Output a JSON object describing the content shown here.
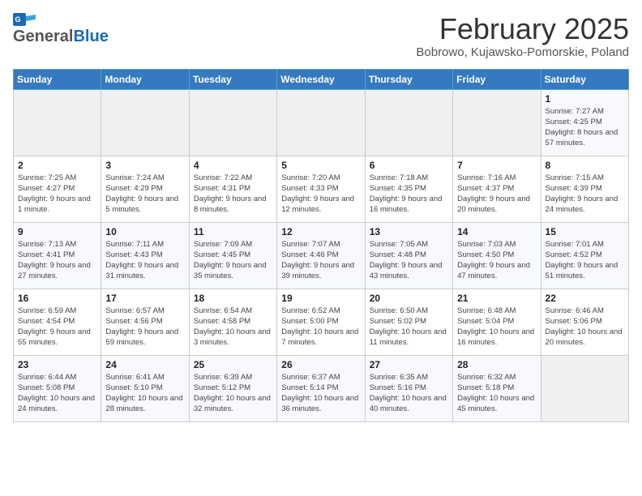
{
  "header": {
    "logo_general": "General",
    "logo_blue": "Blue",
    "title": "February 2025",
    "subtitle": "Bobrowo, Kujawsko-Pomorskie, Poland"
  },
  "weekdays": [
    "Sunday",
    "Monday",
    "Tuesday",
    "Wednesday",
    "Thursday",
    "Friday",
    "Saturday"
  ],
  "weeks": [
    [
      {
        "day": "",
        "info": ""
      },
      {
        "day": "",
        "info": ""
      },
      {
        "day": "",
        "info": ""
      },
      {
        "day": "",
        "info": ""
      },
      {
        "day": "",
        "info": ""
      },
      {
        "day": "",
        "info": ""
      },
      {
        "day": "1",
        "info": "Sunrise: 7:27 AM\nSunset: 4:25 PM\nDaylight: 8 hours and 57 minutes."
      }
    ],
    [
      {
        "day": "2",
        "info": "Sunrise: 7:25 AM\nSunset: 4:27 PM\nDaylight: 9 hours and 1 minute."
      },
      {
        "day": "3",
        "info": "Sunrise: 7:24 AM\nSunset: 4:29 PM\nDaylight: 9 hours and 5 minutes."
      },
      {
        "day": "4",
        "info": "Sunrise: 7:22 AM\nSunset: 4:31 PM\nDaylight: 9 hours and 8 minutes."
      },
      {
        "day": "5",
        "info": "Sunrise: 7:20 AM\nSunset: 4:33 PM\nDaylight: 9 hours and 12 minutes."
      },
      {
        "day": "6",
        "info": "Sunrise: 7:18 AM\nSunset: 4:35 PM\nDaylight: 9 hours and 16 minutes."
      },
      {
        "day": "7",
        "info": "Sunrise: 7:16 AM\nSunset: 4:37 PM\nDaylight: 9 hours and 20 minutes."
      },
      {
        "day": "8",
        "info": "Sunrise: 7:15 AM\nSunset: 4:39 PM\nDaylight: 9 hours and 24 minutes."
      }
    ],
    [
      {
        "day": "9",
        "info": "Sunrise: 7:13 AM\nSunset: 4:41 PM\nDaylight: 9 hours and 27 minutes."
      },
      {
        "day": "10",
        "info": "Sunrise: 7:11 AM\nSunset: 4:43 PM\nDaylight: 9 hours and 31 minutes."
      },
      {
        "day": "11",
        "info": "Sunrise: 7:09 AM\nSunset: 4:45 PM\nDaylight: 9 hours and 35 minutes."
      },
      {
        "day": "12",
        "info": "Sunrise: 7:07 AM\nSunset: 4:46 PM\nDaylight: 9 hours and 39 minutes."
      },
      {
        "day": "13",
        "info": "Sunrise: 7:05 AM\nSunset: 4:48 PM\nDaylight: 9 hours and 43 minutes."
      },
      {
        "day": "14",
        "info": "Sunrise: 7:03 AM\nSunset: 4:50 PM\nDaylight: 9 hours and 47 minutes."
      },
      {
        "day": "15",
        "info": "Sunrise: 7:01 AM\nSunset: 4:52 PM\nDaylight: 9 hours and 51 minutes."
      }
    ],
    [
      {
        "day": "16",
        "info": "Sunrise: 6:59 AM\nSunset: 4:54 PM\nDaylight: 9 hours and 55 minutes."
      },
      {
        "day": "17",
        "info": "Sunrise: 6:57 AM\nSunset: 4:56 PM\nDaylight: 9 hours and 59 minutes."
      },
      {
        "day": "18",
        "info": "Sunrise: 6:54 AM\nSunset: 4:58 PM\nDaylight: 10 hours and 3 minutes."
      },
      {
        "day": "19",
        "info": "Sunrise: 6:52 AM\nSunset: 5:00 PM\nDaylight: 10 hours and 7 minutes."
      },
      {
        "day": "20",
        "info": "Sunrise: 6:50 AM\nSunset: 5:02 PM\nDaylight: 10 hours and 11 minutes."
      },
      {
        "day": "21",
        "info": "Sunrise: 6:48 AM\nSunset: 5:04 PM\nDaylight: 10 hours and 16 minutes."
      },
      {
        "day": "22",
        "info": "Sunrise: 6:46 AM\nSunset: 5:06 PM\nDaylight: 10 hours and 20 minutes."
      }
    ],
    [
      {
        "day": "23",
        "info": "Sunrise: 6:44 AM\nSunset: 5:08 PM\nDaylight: 10 hours and 24 minutes."
      },
      {
        "day": "24",
        "info": "Sunrise: 6:41 AM\nSunset: 5:10 PM\nDaylight: 10 hours and 28 minutes."
      },
      {
        "day": "25",
        "info": "Sunrise: 6:39 AM\nSunset: 5:12 PM\nDaylight: 10 hours and 32 minutes."
      },
      {
        "day": "26",
        "info": "Sunrise: 6:37 AM\nSunset: 5:14 PM\nDaylight: 10 hours and 36 minutes."
      },
      {
        "day": "27",
        "info": "Sunrise: 6:35 AM\nSunset: 5:16 PM\nDaylight: 10 hours and 40 minutes."
      },
      {
        "day": "28",
        "info": "Sunrise: 6:32 AM\nSunset: 5:18 PM\nDaylight: 10 hours and 45 minutes."
      },
      {
        "day": "",
        "info": ""
      }
    ]
  ]
}
